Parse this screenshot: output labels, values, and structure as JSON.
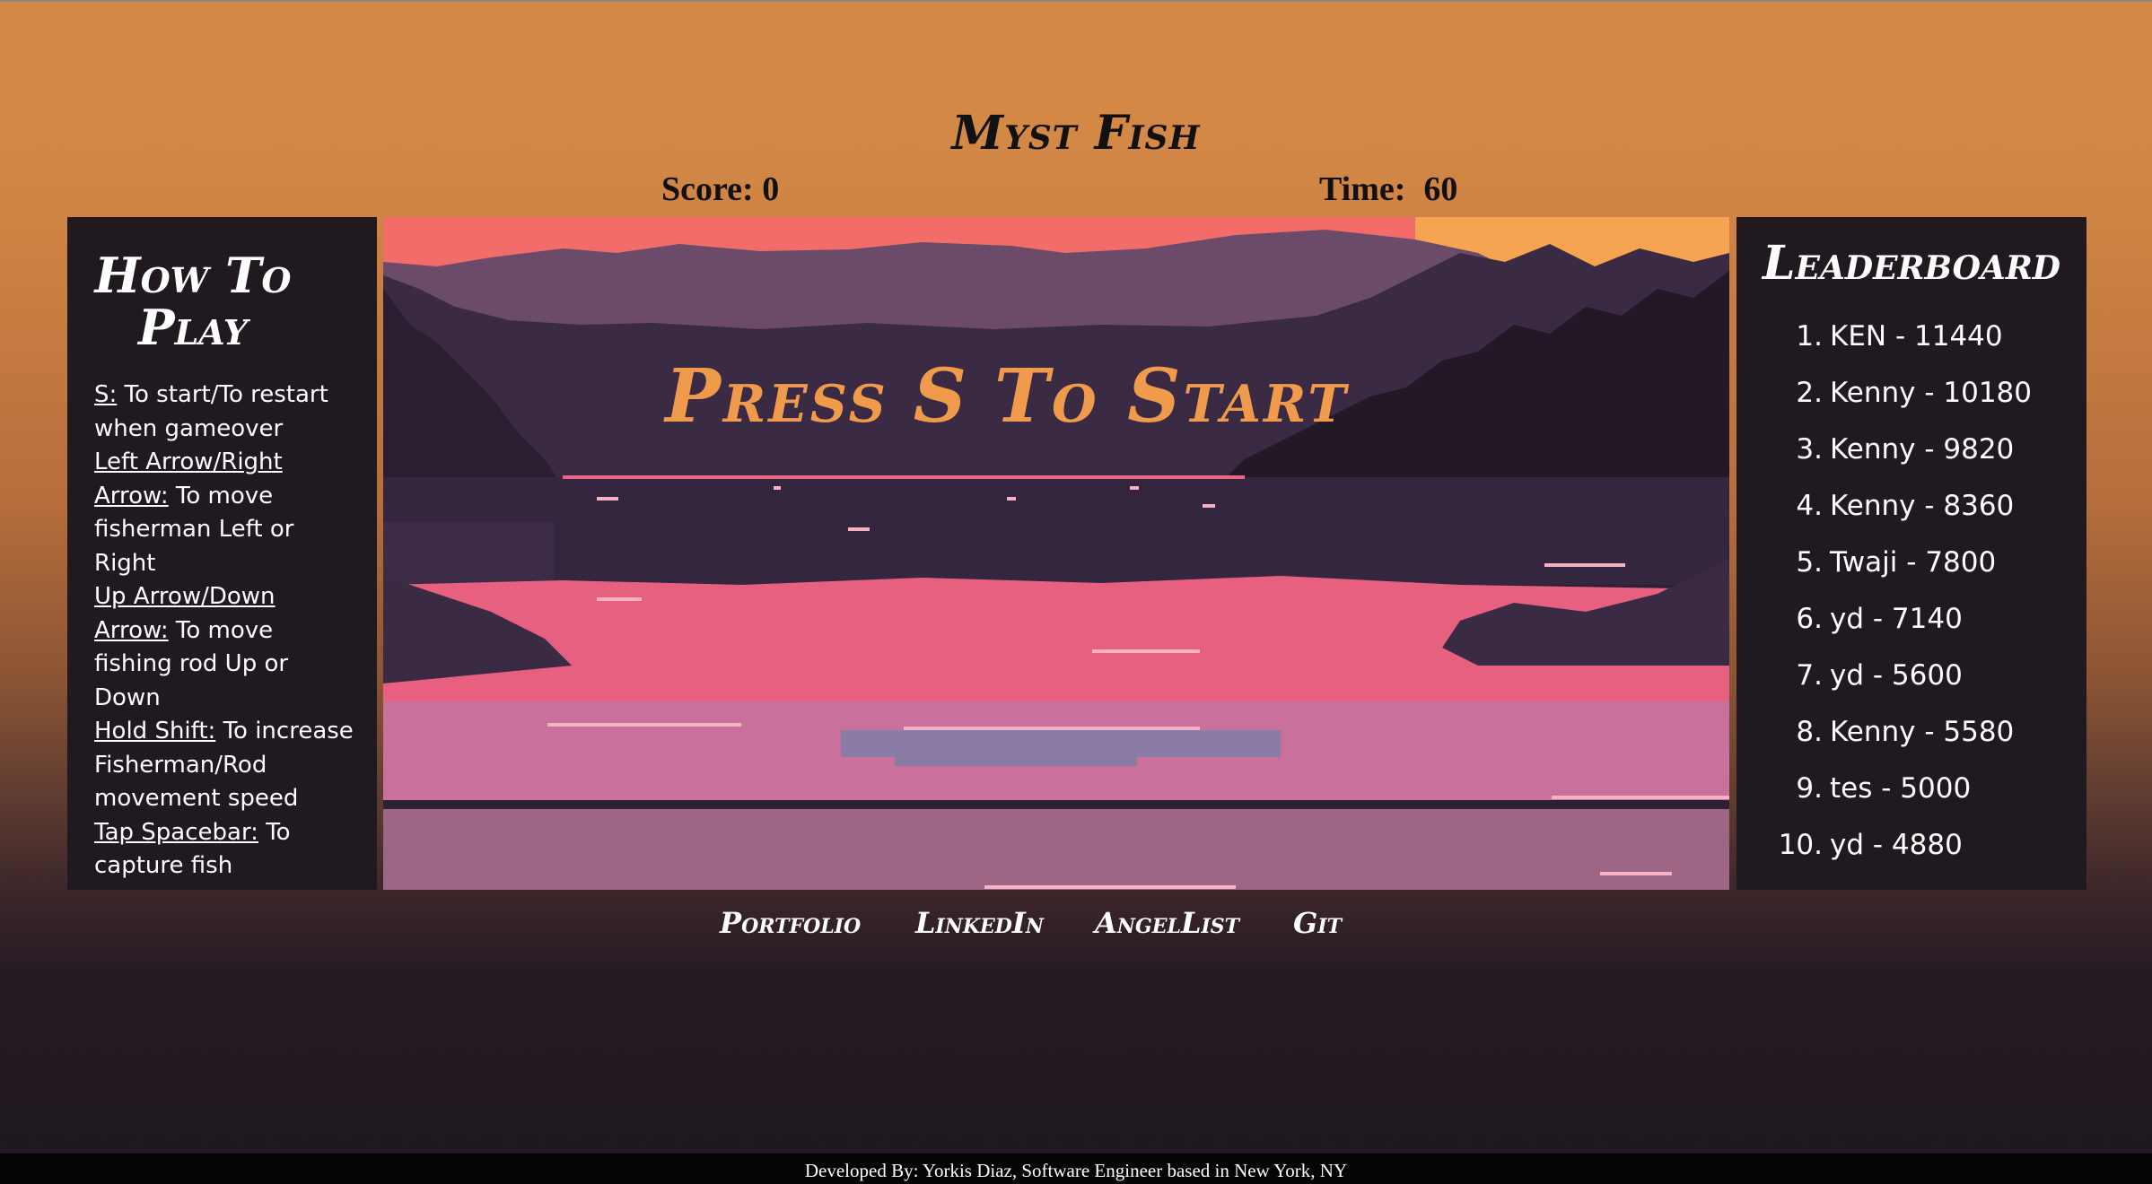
{
  "game": {
    "title": "Myst Fish",
    "score_label": "Score:",
    "score_value": "0",
    "time_label": "Time:",
    "time_value": "60",
    "overlay": {
      "press": "Press",
      "key": "S",
      "to_start": "To Start"
    }
  },
  "how_to_play": {
    "title_line1": "How To",
    "title_line2": "Play",
    "instructions": [
      {
        "key": "S:",
        "text": " To start/To restart when gameover"
      },
      {
        "key": "Left Arrow/Right Arrow:",
        "text": " To move fisherman Left or Right"
      },
      {
        "key": "Up Arrow/Down Arrow:",
        "text": " To move fishing rod Up or Down"
      },
      {
        "key": "Hold Shift:",
        "text": " To increase Fisherman/Rod movement speed"
      },
      {
        "key": "Tap Spacebar:",
        "text": " To capture fish"
      }
    ]
  },
  "leaderboard": {
    "title": "Leaderboard",
    "entries": [
      {
        "rank": "1.",
        "entry": "KEN - 11440"
      },
      {
        "rank": "2.",
        "entry": "Kenny - 10180"
      },
      {
        "rank": "3.",
        "entry": "Kenny - 9820"
      },
      {
        "rank": "4.",
        "entry": "Kenny - 8360"
      },
      {
        "rank": "5.",
        "entry": "Twaji - 7800"
      },
      {
        "rank": "6.",
        "entry": "yd - 7140"
      },
      {
        "rank": "7.",
        "entry": "yd - 5600"
      },
      {
        "rank": "8.",
        "entry": "Kenny - 5580"
      },
      {
        "rank": "9.",
        "entry": "tes - 5000"
      },
      {
        "rank": "10.",
        "entry": "yd - 4880"
      }
    ]
  },
  "links": {
    "portfolio": "Portfolio",
    "linkedin": "LinkedIn",
    "angellist": "AngelList",
    "git": "Git"
  },
  "footer": {
    "text": "Developed By: Yorkis Diaz, Software Engineer based in New York, NY"
  },
  "colors": {
    "background_top": "#d48848",
    "background_bottom": "#1f1820",
    "panel": "#211920",
    "overlay_text": "#f09a4c"
  }
}
